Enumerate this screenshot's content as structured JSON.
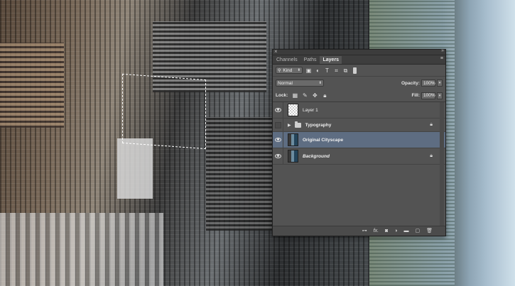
{
  "panel": {
    "tabs": [
      "Channels",
      "Paths",
      "Layers"
    ],
    "active_tab": "Layers",
    "filter": {
      "kind_label": "Kind"
    },
    "blend_mode": "Normal",
    "opacity_label": "Opacity:",
    "opacity_value": "100%",
    "lock_label": "Lock:",
    "fill_label": "Fill:",
    "fill_value": "100%",
    "layers": [
      {
        "name": "Layer 1",
        "visible": true,
        "type": "pixel",
        "selected": false,
        "locked": false
      },
      {
        "name": "Typography",
        "visible": false,
        "type": "group",
        "selected": false,
        "locked": true
      },
      {
        "name": "Original Cityscape",
        "visible": true,
        "type": "smart",
        "selected": true,
        "locked": false
      },
      {
        "name": "Background",
        "visible": true,
        "type": "background",
        "selected": false,
        "locked": true
      }
    ],
    "colors": {
      "panel_bg": "#535353",
      "selection": "#5e6d82",
      "tab_bar": "#3e3e3e"
    }
  }
}
